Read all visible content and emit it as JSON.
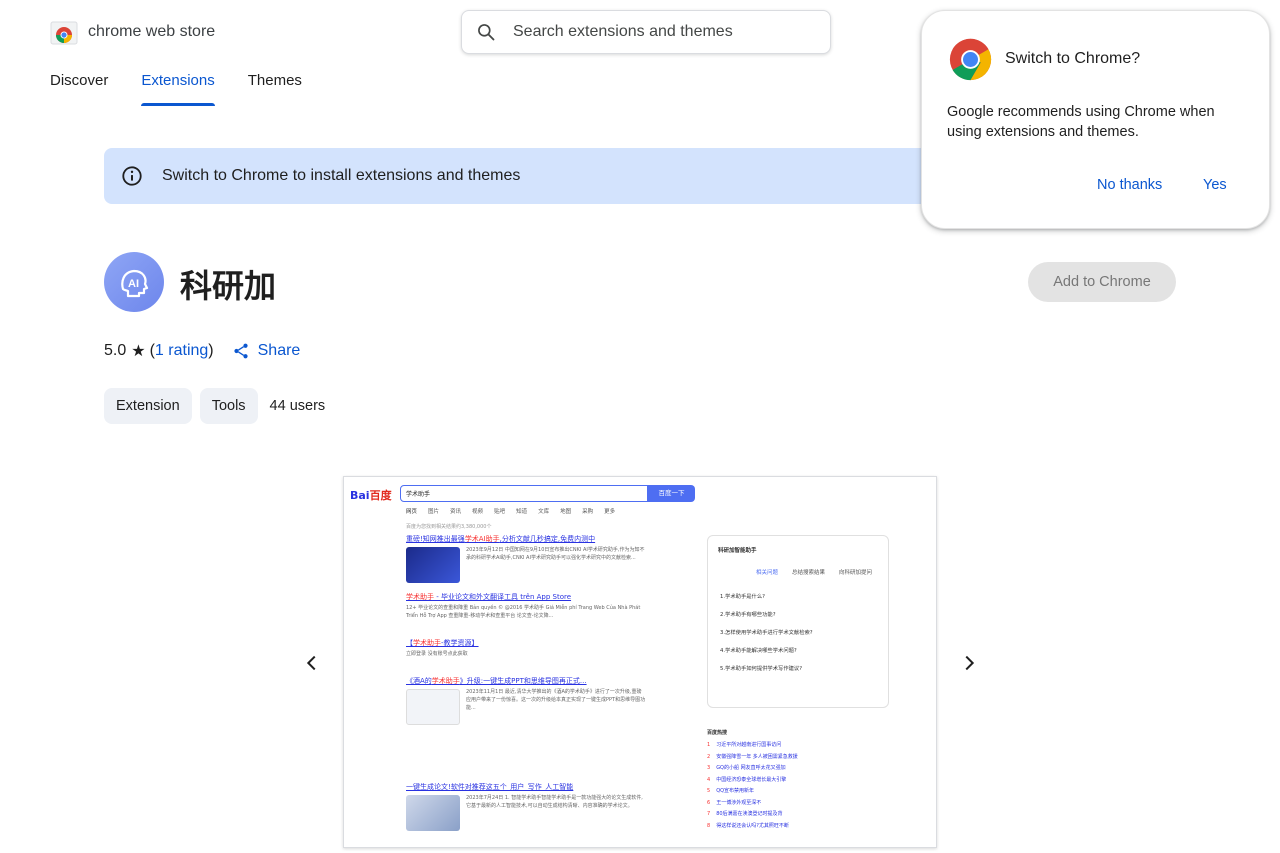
{
  "header": {
    "store_name": "chrome web store",
    "search_placeholder": "Search extensions and themes"
  },
  "nav": {
    "tabs": [
      {
        "label": "Discover"
      },
      {
        "label": "Extensions",
        "active": true
      },
      {
        "label": "Themes"
      }
    ]
  },
  "banner": {
    "text": "Switch to Chrome to install extensions and themes",
    "icon": "info-icon",
    "background": "#d3e3fd"
  },
  "extension": {
    "name": "科研加",
    "icon_text": "AI",
    "add_button": "Add to Chrome",
    "rating_value": "5.0",
    "rating_count": "1 rating",
    "share_label": "Share",
    "chips": [
      "Extension",
      "Tools"
    ],
    "users": "44 users"
  },
  "screenshot": {
    "logo_text": "Bai",
    "logo_text_2": "百度",
    "search_query": "学术助手",
    "search_button": "百度一下",
    "tabs": [
      "网页",
      "图片",
      "资讯",
      "视频",
      "贴吧",
      "知道",
      "文库",
      "地图",
      "采购",
      "更多"
    ],
    "results_count": "百度为您找到相关结果约3,380,000个",
    "results": [
      {
        "title_pre": "重磅!知网推出最强",
        "title_hl": "学术AI助手",
        "title_post": ",分析文献几秒搞定,免费内测中",
        "snippet": "2023年9月12日 中国知网在9月10日宣布推出CNKI AI学术研究助手,作为为知不承的科研学术AI助手,CNKI AI学术研究助手可以强化学术研究中的文献检索..."
      },
      {
        "title_pre": "",
        "title_hl": "学术助手",
        "title_post": " - 毕业论文和外文翻译工具 trên App Store",
        "snippet": "12+ 毕业论文的查重和降重 Bản quyền © @2016 学术助手 Giá Miễn phí Trang Web Của Nhà Phát Triển Hỗ Trợ App 查重降重-移动学术和查重平台 论文查-论文降..."
      },
      {
        "title_pre": "【",
        "title_hl": "学术助手",
        "title_post": "-教学资源】",
        "snippet": "立即登录 没有账号点此获取"
      },
      {
        "title_pre": "《酒A的",
        "title_hl": "学术助手",
        "title_post": "》升级:一键生成PPT和思维导图再正式...",
        "snippet": "2023年11月1日 最近,清华大学推出的《酒A的学术助手》进行了一次升级,重磅应用户带来了一份惊喜。这一次的升级给本真正实现了一键生成PPT和思维导图功能..."
      },
      {
        "title_pre": "一键生成论文!",
        "title_hl": "",
        "title_post": "软件对推荐这五个_用户_写作_人工智能",
        "snippet": "2023年7月24日 1. 智能学术助手智能学术助手是一款功能强大的论文生成软件,它基于最新的人工智能技术,可以自动生成结构清晰、内容准确的学术论文。"
      }
    ],
    "ai_panel": {
      "title": "科研加智能助手",
      "tabs": [
        "相关问题",
        "总结搜索结果",
        "向科研加提问"
      ],
      "questions": [
        "1.学术助手是什么?",
        "2.学术助手有哪些功能?",
        "3.怎样使用学术助手进行学术文献检索?",
        "4.学术助手能解决哪些学术问题?",
        "5.学术助手如何提供学术写作建议?"
      ]
    },
    "hot": {
      "title": "百度热搜",
      "items": [
        "习近平所对越南进行国事访问",
        "安徽强降雪一年 多人被困需紧急救援",
        "GQ的小船 网友直呼太花又强加",
        "中国经济恐泰全球增长最大引擎",
        "QQ宣布禁用新年",
        "王一博涉外观至深不",
        "80后满嘉在渎澳登记时提及背",
        "得这样说还会认吗?尤其照旺不断"
      ]
    }
  },
  "popup": {
    "title": "Switch to Chrome?",
    "body": "Google recommends using Chrome when using extensions and themes.",
    "no_button": "No thanks",
    "yes_button": "Yes"
  },
  "colors": {
    "accent": "#0b57d0",
    "banner_bg": "#d3e3fd",
    "button_disabled_bg": "#e3e3e3"
  }
}
